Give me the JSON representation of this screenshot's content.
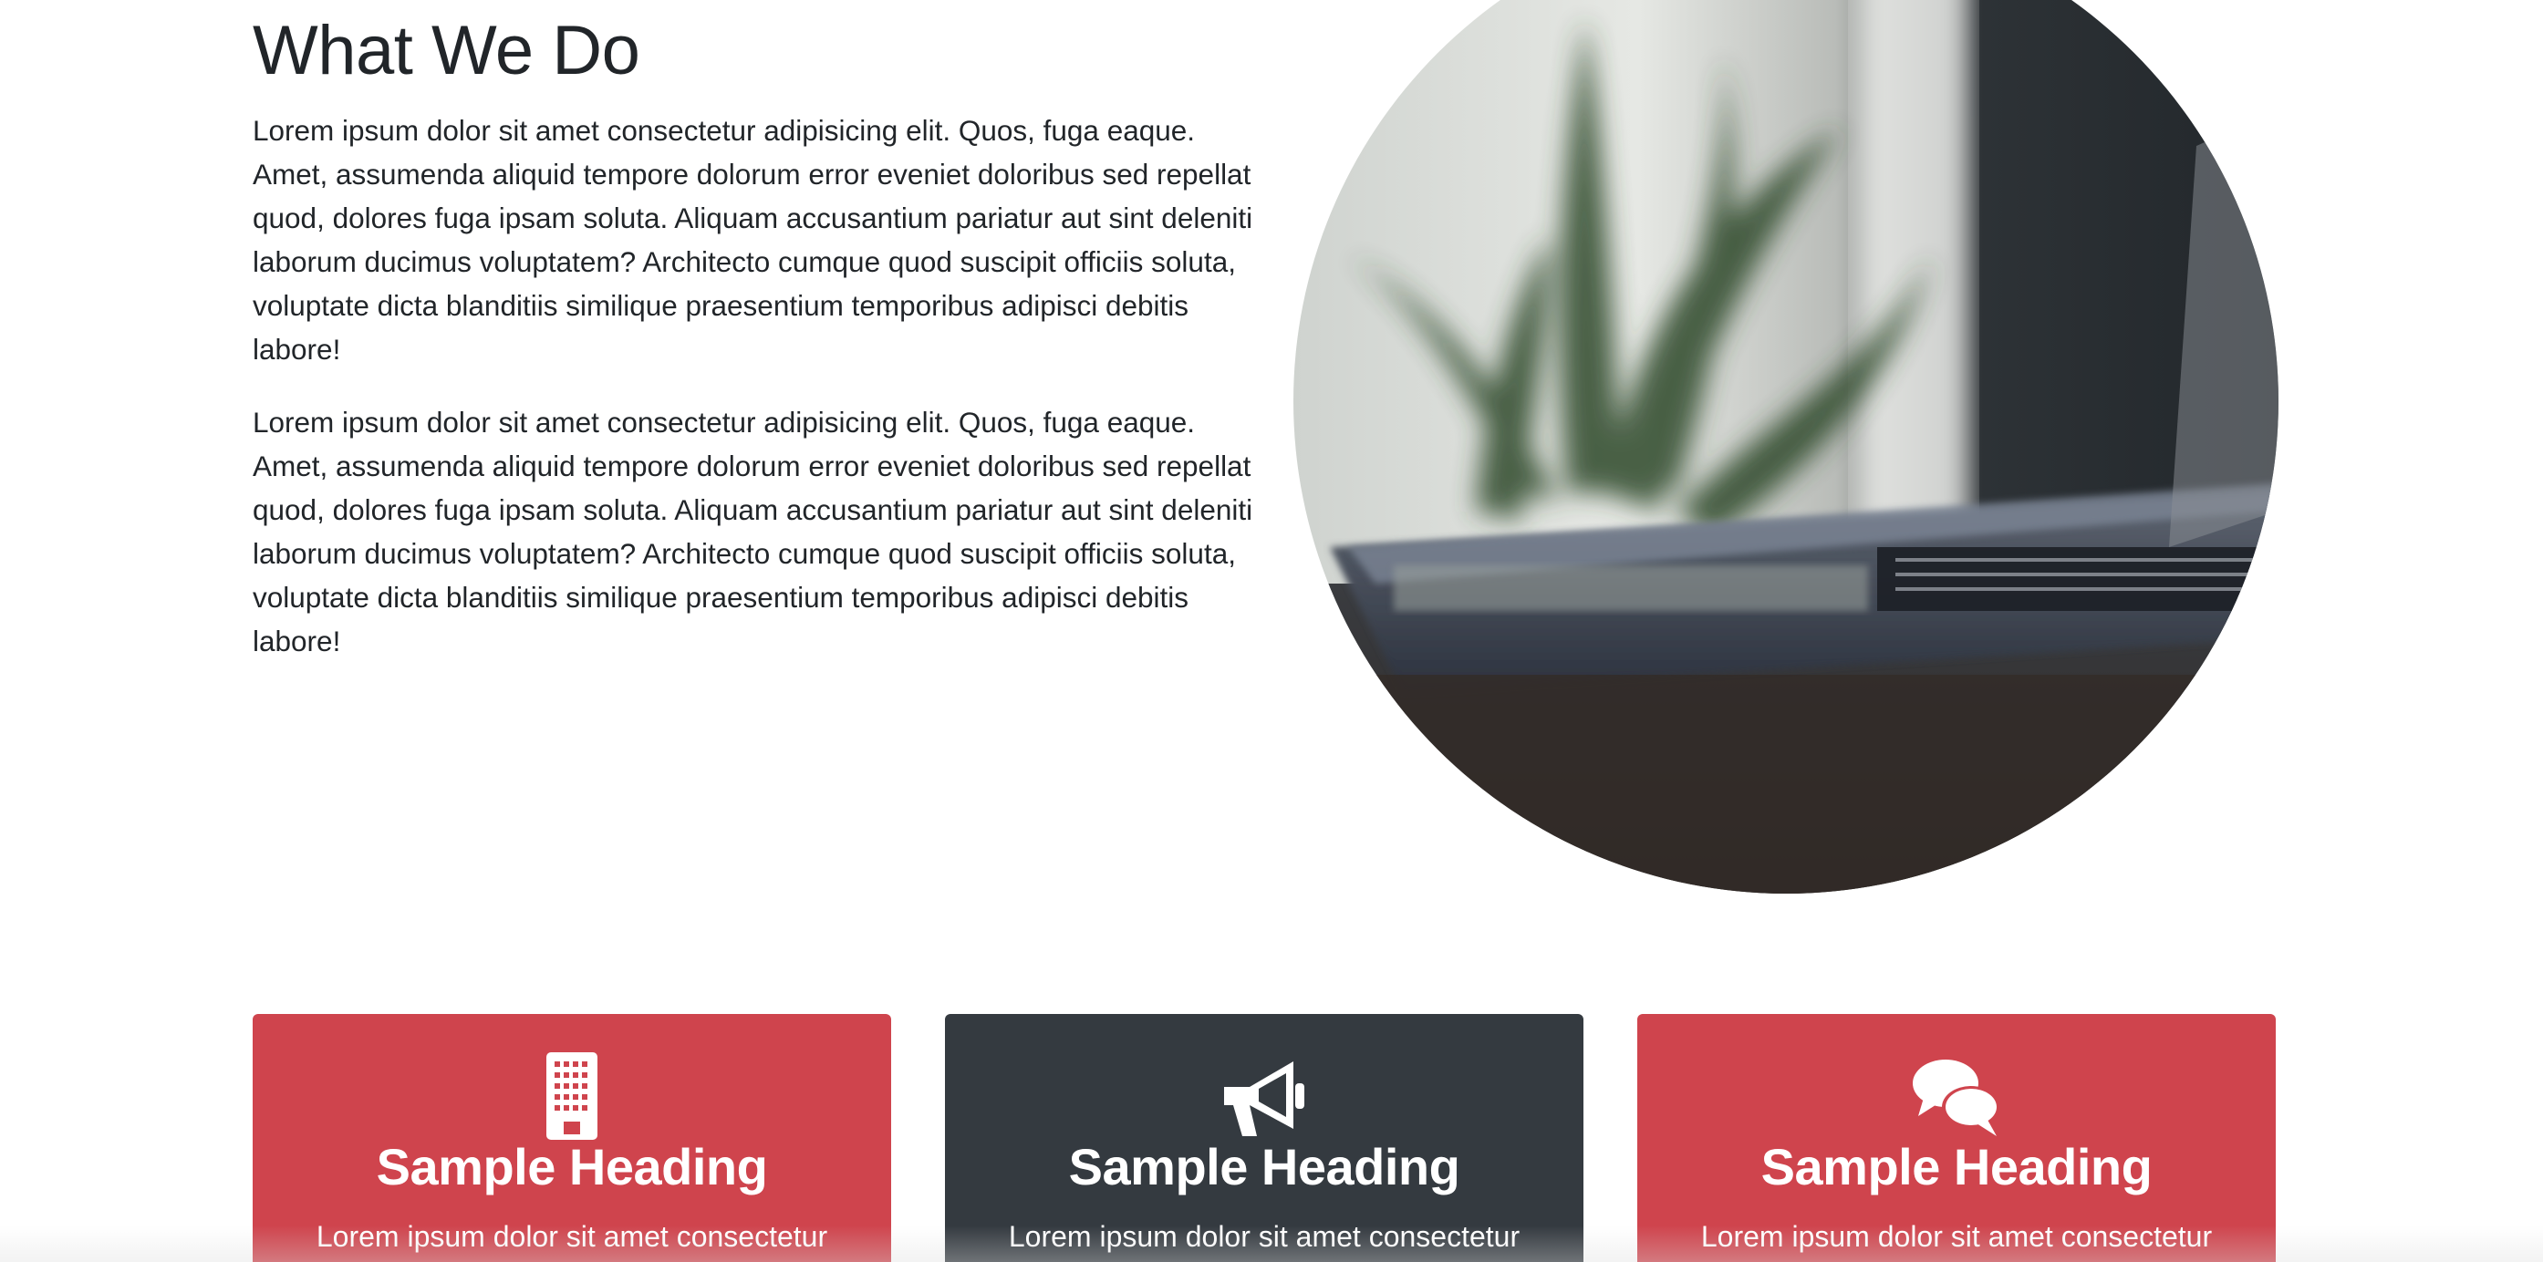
{
  "about": {
    "title": "What We Do",
    "paragraphs": [
      "Lorem ipsum dolor sit amet consectetur adipisicing elit. Quos, fuga eaque. Amet, assumenda aliquid tempore dolorum error eveniet doloribus sed repellat quod, dolores fuga ipsam soluta. Aliquam accusantium pariatur aut sint deleniti laborum ducimus voluptatem? Architecto cumque quod suscipit officiis soluta, voluptate dicta blanditiis similique praesentium temporibus adipisci debitis labore!",
      "Lorem ipsum dolor sit amet consectetur adipisicing elit. Quos, fuga eaque. Amet, assumenda aliquid tempore dolorum error eveniet doloribus sed repellat quod, dolores fuga ipsam soluta. Aliquam accusantium pariatur aut sint deleniti laborum ducimus voluptatem? Architecto cumque quod suscipit officiis soluta, voluptate dicta blanditiis similique praesentium temporibus adipisci debitis labore!"
    ],
    "image": {
      "icon": "laptop-plant-photo"
    }
  },
  "cards": [
    {
      "icon": "building-icon",
      "heading": "Sample Heading",
      "text": "Lorem ipsum dolor sit amet consectetur",
      "color": "#cf444d"
    },
    {
      "icon": "bullhorn-icon",
      "heading": "Sample Heading",
      "text": "Lorem ipsum dolor sit amet consectetur",
      "color": "#343a40"
    },
    {
      "icon": "comments-icon",
      "heading": "Sample Heading",
      "text": "Lorem ipsum dolor sit amet consectetur",
      "color": "#cf444d"
    }
  ],
  "colors": {
    "text": "#212529",
    "accent_red": "#cf444d",
    "dark": "#343a40",
    "background": "#ffffff"
  }
}
